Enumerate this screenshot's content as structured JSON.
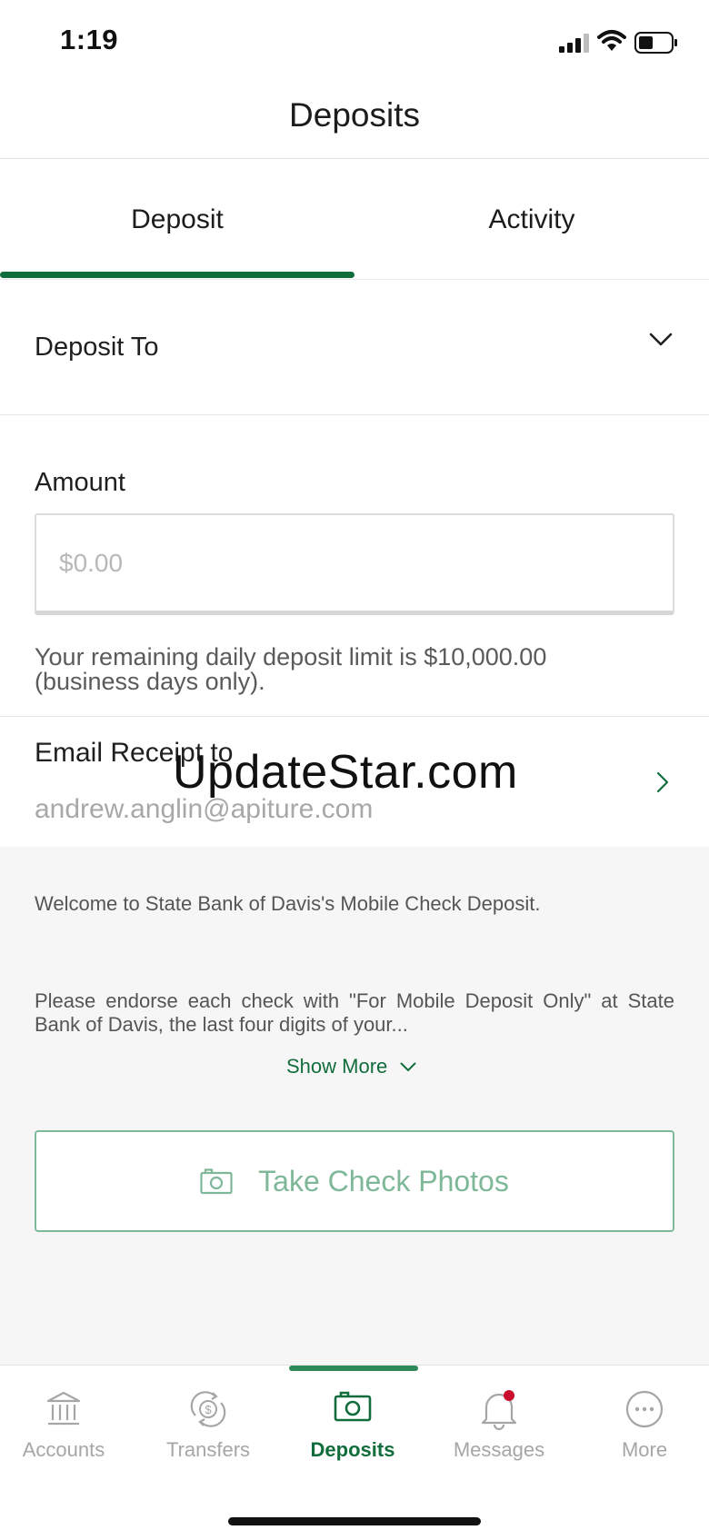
{
  "status_bar": {
    "time": "1:19"
  },
  "header": {
    "title": "Deposits"
  },
  "tabs": [
    {
      "label": "Deposit",
      "selected": true
    },
    {
      "label": "Activity",
      "selected": false
    }
  ],
  "deposit_to": {
    "label": "Deposit To"
  },
  "amount": {
    "label": "Amount",
    "placeholder": "$0.00",
    "value": ""
  },
  "limit_note": "Your remaining daily deposit limit is $10,000.00 (business days only).",
  "email_receipt": {
    "label": "Email Receipt to",
    "value": "andrew.anglin@apiture.com"
  },
  "watermark": "UpdateStar.com",
  "info": {
    "welcome": "Welcome to State Bank of Davis's Mobile Check Deposit.",
    "endorse": "Please endorse each check with \"For Mobile Deposit Only\" at State Bank of Davis, the last four digits of your...",
    "show_more": "Show More"
  },
  "take_photos_button": {
    "label": "Take Check Photos",
    "icon": "camera-icon"
  },
  "bottom_nav": [
    {
      "label": "Accounts",
      "icon": "bank-icon",
      "active": false
    },
    {
      "label": "Transfers",
      "icon": "transfer-icon",
      "active": false
    },
    {
      "label": "Deposits",
      "icon": "camera-icon",
      "active": true
    },
    {
      "label": "Messages",
      "icon": "bell-icon",
      "active": false,
      "badge": true
    },
    {
      "label": "More",
      "icon": "more-icon",
      "active": false
    }
  ],
  "colors": {
    "brand_green": "#116d3c",
    "button_green_light": "#7fb899",
    "badge_red": "#c8102e",
    "inactive_gray": "#a6a6a6"
  }
}
